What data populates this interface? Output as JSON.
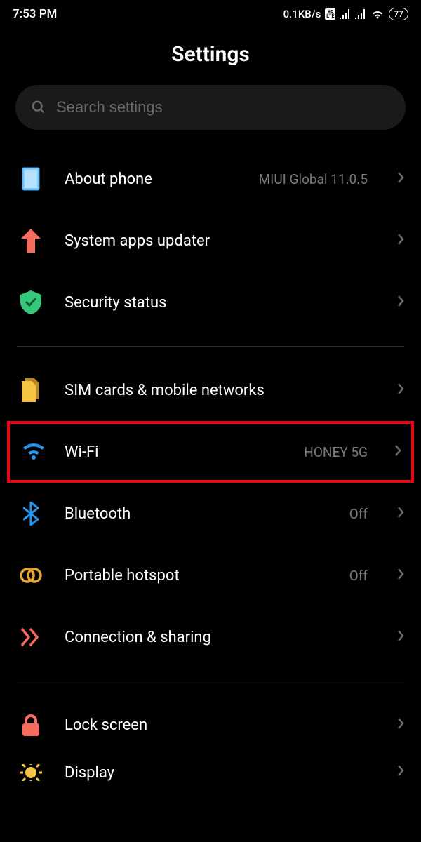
{
  "status": {
    "time": "7:53 PM",
    "net_speed": "0.1KB/s",
    "battery": "77"
  },
  "title": "Settings",
  "search": {
    "placeholder": "Search settings"
  },
  "rows": {
    "about": {
      "label": "About phone",
      "value": "MIUI Global 11.0.5"
    },
    "updater": {
      "label": "System apps updater",
      "value": ""
    },
    "security": {
      "label": "Security status",
      "value": ""
    },
    "sim": {
      "label": "SIM cards & mobile networks",
      "value": ""
    },
    "wifi": {
      "label": "Wi-Fi",
      "value": "HONEY 5G"
    },
    "bluetooth": {
      "label": "Bluetooth",
      "value": "Off"
    },
    "hotspot": {
      "label": "Portable hotspot",
      "value": "Off"
    },
    "connshare": {
      "label": "Connection & sharing",
      "value": ""
    },
    "lock": {
      "label": "Lock screen",
      "value": ""
    },
    "display": {
      "label": "Display",
      "value": ""
    }
  }
}
